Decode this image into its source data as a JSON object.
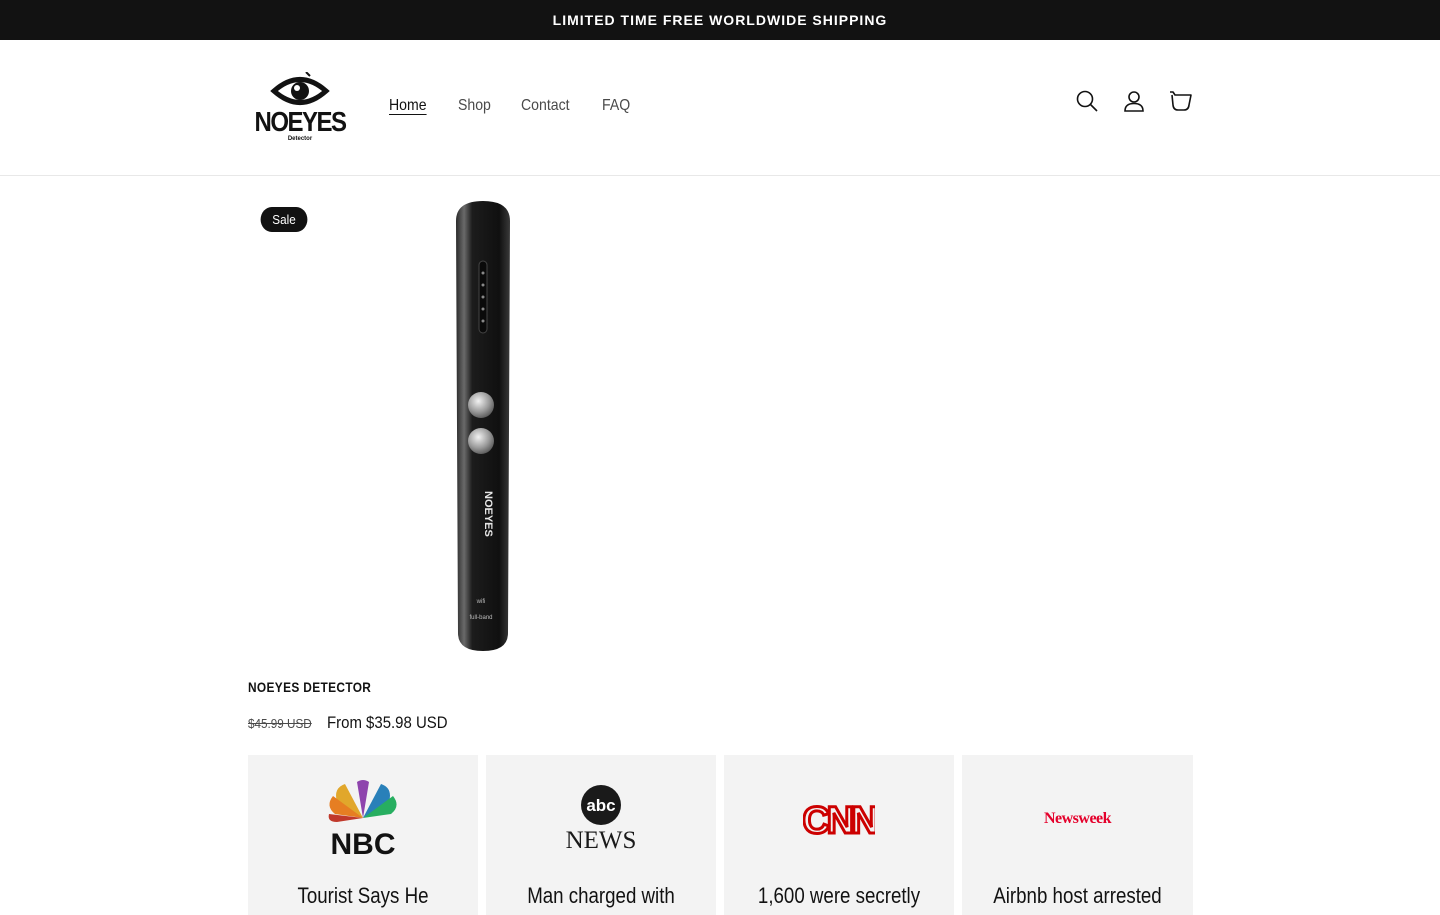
{
  "announcement": {
    "text": "LIMITED TIME FREE WORLDWIDE SHIPPING"
  },
  "header": {
    "logo": {
      "word": "NOEYES",
      "sub": "Detector"
    },
    "nav": [
      {
        "label": "Home",
        "active": true
      },
      {
        "label": "Shop",
        "active": false
      },
      {
        "label": "Contact",
        "active": false
      },
      {
        "label": "FAQ",
        "active": false
      }
    ],
    "icons": [
      "search-icon",
      "account-icon",
      "cart-icon"
    ]
  },
  "product": {
    "badge": "Sale",
    "title": "NOEYES DETECTOR",
    "price_old": "$45.99 USD",
    "price_new": "From $35.98 USD",
    "device_text": "NOEYES",
    "device_labels": [
      "wifi",
      "full-band"
    ]
  },
  "press": [
    {
      "outlet": "NBC",
      "headline": "Tourist Says He"
    },
    {
      "outlet": "abc NEWS",
      "headline": "Man charged with"
    },
    {
      "outlet": "CNN",
      "headline": "1,600 were secretly"
    },
    {
      "outlet": "Newsweek",
      "headline": "Airbnb host arrested"
    }
  ],
  "colors": {
    "dark": "#121212",
    "cnn_red": "#cc0000",
    "newsweek_red": "#e4002b",
    "card_bg": "#f3f3f3"
  }
}
